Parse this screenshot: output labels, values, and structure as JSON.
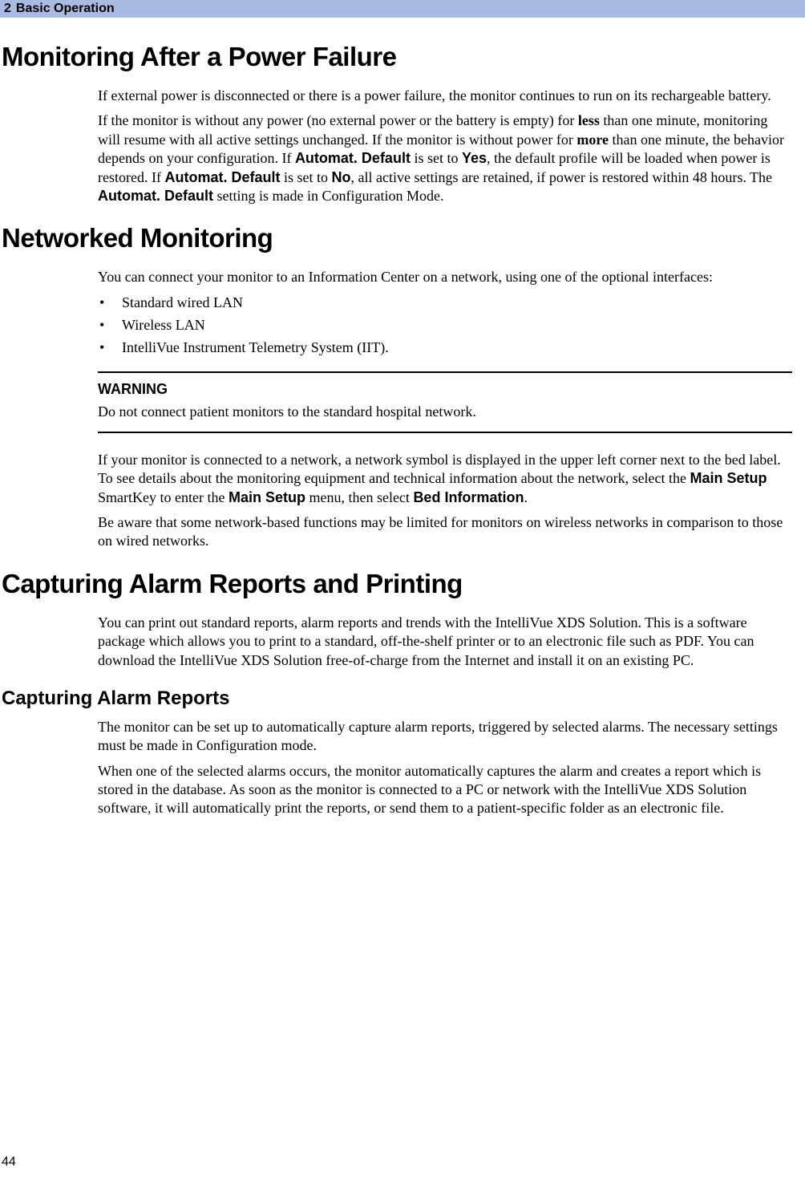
{
  "header": {
    "chapter_number": "2",
    "chapter_title": "Basic Operation"
  },
  "sections": {
    "monitoring_power_failure": {
      "heading": "Monitoring After a Power Failure",
      "p1": "If external power is disconnected or there is a power failure, the monitor continues to run on its rechargeable battery.",
      "p2_a": "If the monitor is without any power (no external power or the battery is empty) for ",
      "p2_b": "less",
      "p2_c": " than one minute, monitoring will resume with all active settings unchanged. If the monitor is without power for ",
      "p2_d": "more",
      "p2_e": " than one minute, the behavior depends on your configuration. If ",
      "p2_f": "Automat. Default",
      "p2_g": " is set to ",
      "p2_h": "Yes",
      "p2_i": ", the default profile will be loaded when power is restored. If ",
      "p2_j": "Automat. Default",
      "p2_k": " is set to ",
      "p2_l": "No",
      "p2_m": ", all active settings are retained, if power is restored within 48 hours. The ",
      "p2_n": "Automat. Default",
      "p2_o": " setting is made in Configuration Mode."
    },
    "networked_monitoring": {
      "heading": "Networked Monitoring",
      "intro": "You can connect your monitor to an Information Center on a network, using one of the optional interfaces:",
      "bullets": [
        "Standard wired LAN",
        "Wireless LAN",
        "IntelliVue Instrument Telemetry System (IIT)."
      ],
      "warning": {
        "label": "WARNING",
        "text": "Do not connect patient monitors to the standard hospital network."
      },
      "p2_a": "If your monitor is connected to a network, a network symbol is displayed in the upper left corner next to the bed label. To see details about the monitoring equipment and technical information about the network, select the ",
      "p2_b": "Main Setup",
      "p2_c": " SmartKey to enter the ",
      "p2_d": "Main Setup",
      "p2_e": " menu, then select ",
      "p2_f": "Bed Information",
      "p2_g": ".",
      "p3": "Be aware that some network-based functions may be limited for monitors on wireless networks in comparison to those on wired networks."
    },
    "capturing": {
      "heading": "Capturing Alarm Reports and Printing",
      "p1": "You can print out standard reports, alarm reports and trends with the IntelliVue XDS Solution. This is a software package which allows you to print to a standard, off-the-shelf printer or to an electronic file such as PDF. You can download the IntelliVue XDS Solution free-of-charge from the Internet and install it on an existing PC.",
      "sub": {
        "heading": "Capturing Alarm Reports",
        "p1": "The monitor can be set up to automatically capture alarm reports, triggered by selected alarms. The necessary settings must be made in Configuration mode.",
        "p2": "When one of the selected alarms occurs, the monitor automatically captures the alarm and creates a report which is stored in the database. As soon as the monitor is connected to a PC or network with the IntelliVue XDS Solution software, it will automatically print the reports, or send them to a patient-specific folder as an electronic file."
      }
    }
  },
  "page_number": "44"
}
